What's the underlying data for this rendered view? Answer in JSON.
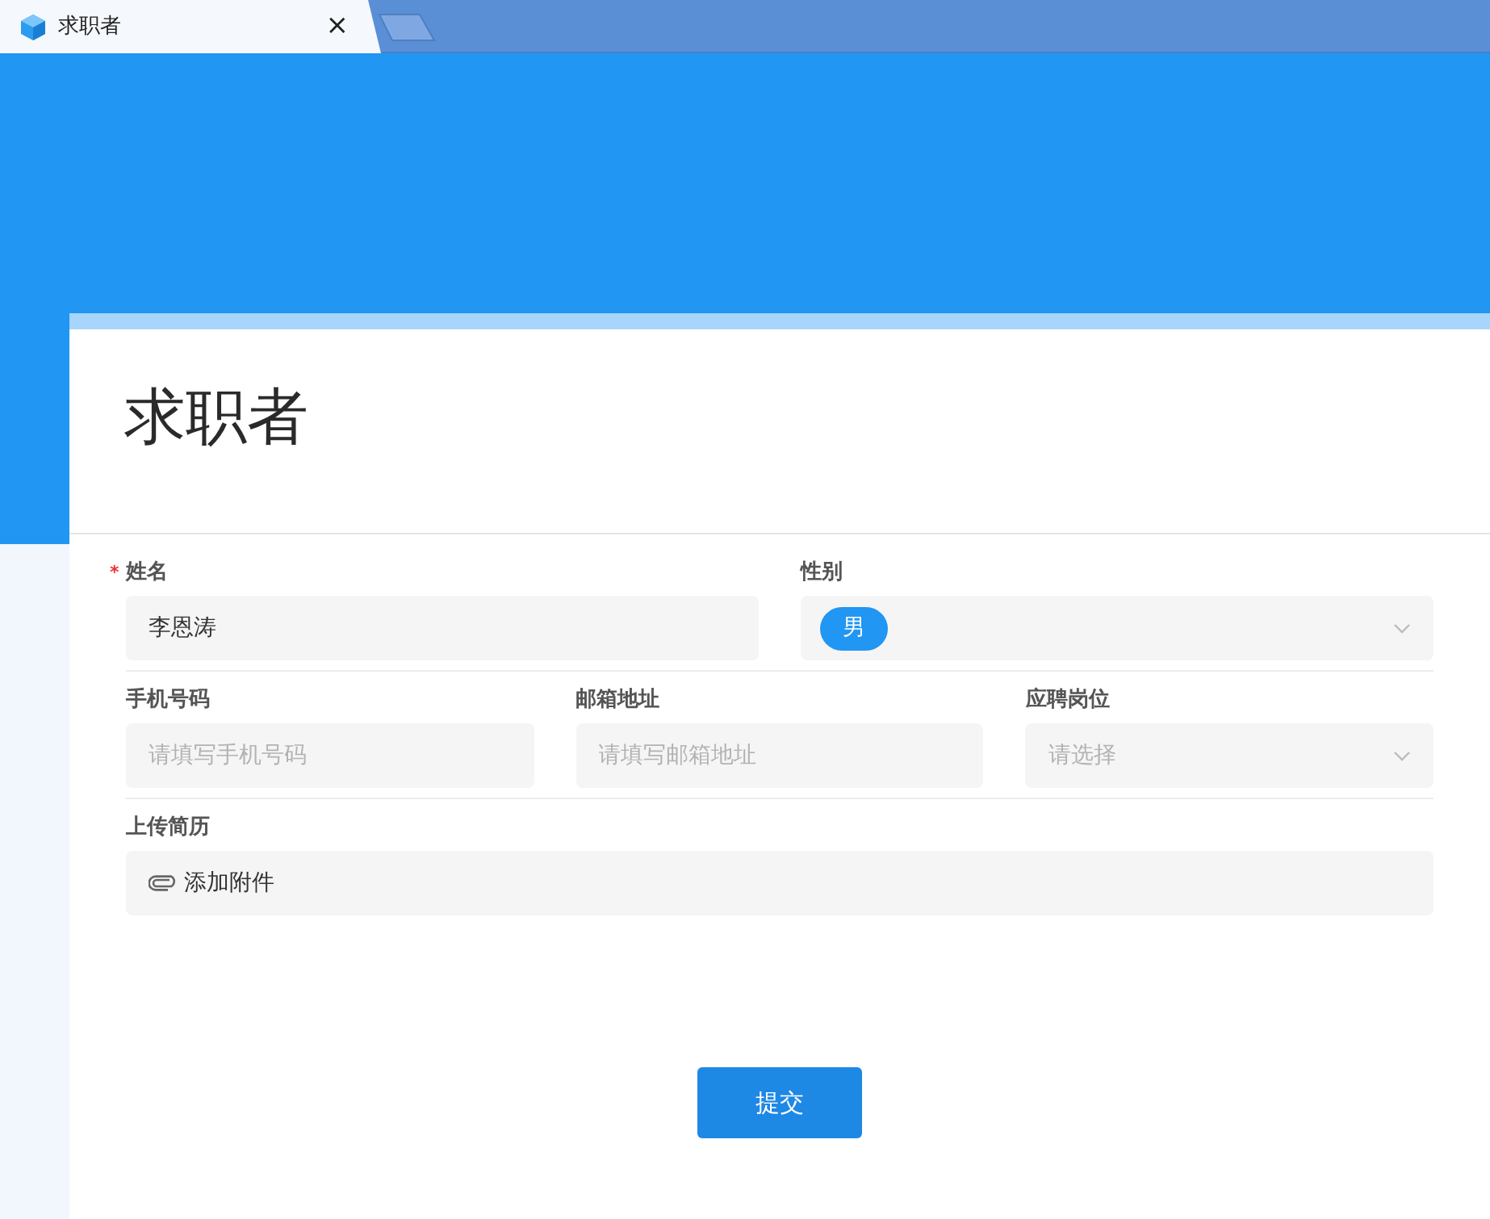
{
  "browser_tab": {
    "title": "求职者",
    "close": "×"
  },
  "form": {
    "title": "求职者",
    "rows": [
      [
        {
          "kind": "text",
          "label": "姓名",
          "required_mark": "*",
          "value": "李恩涛"
        },
        {
          "kind": "select",
          "label": "性别",
          "tag": "男"
        }
      ],
      [
        {
          "kind": "text",
          "label": "手机号码",
          "placeholder": "请填写手机号码"
        },
        {
          "kind": "text",
          "label": "邮箱地址",
          "placeholder": "请填写邮箱地址"
        },
        {
          "kind": "select",
          "label": "应聘岗位",
          "placeholder": "请选择"
        }
      ],
      [
        {
          "kind": "upload",
          "label": "上传简历",
          "action": "添加附件"
        }
      ]
    ],
    "submit": "提交"
  }
}
